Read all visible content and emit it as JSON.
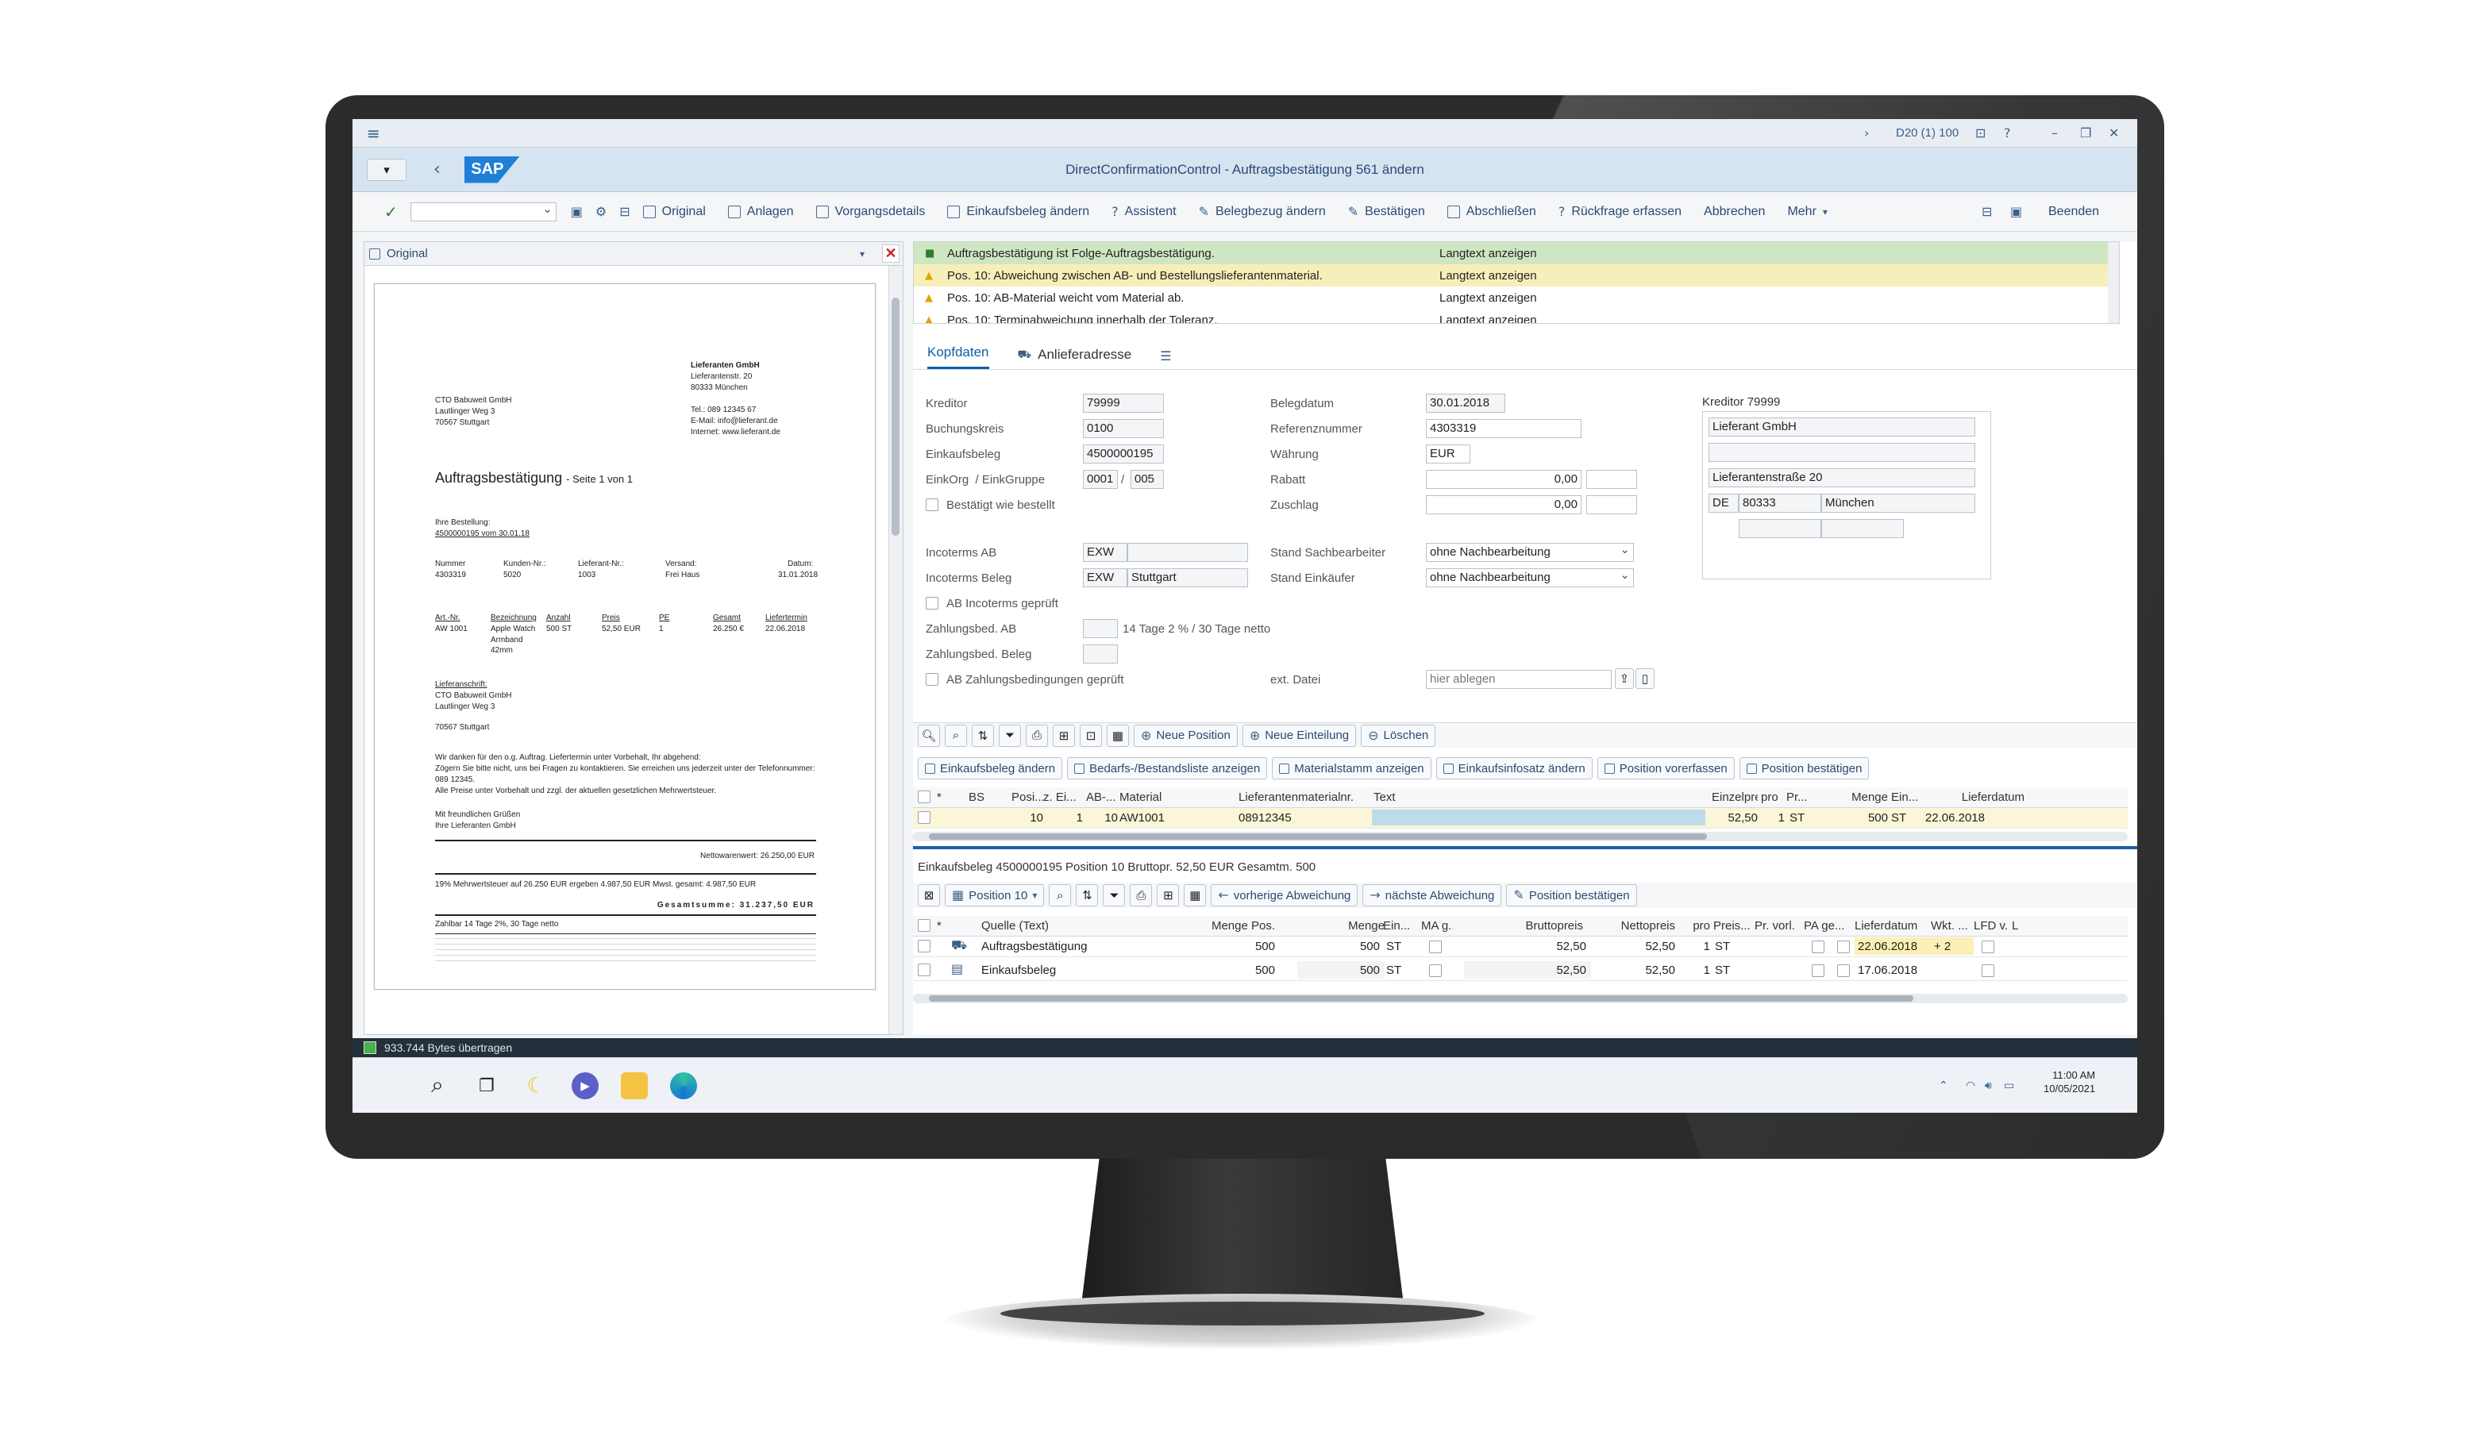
{
  "shell": {
    "menu_icon": "hamburger-icon",
    "system_info": "D20 (1) 100",
    "logo_text": "SAP",
    "window_title": "DirectConfirmationControl - Auftragsbestätigung 561 ändern"
  },
  "toolbar": {
    "items": [
      "Original",
      "Anlagen",
      "Vorgangsdetails",
      "Einkaufsbeleg ändern",
      "Assistent",
      "Belegbezug ändern",
      "Bestätigen",
      "Abschließen",
      "Rückfrage erfassen",
      "Abbrechen",
      "Mehr"
    ],
    "end_label": "Beenden"
  },
  "left_pane": {
    "header_label": "Original",
    "doc": {
      "sender_name": "Lieferanten GmbH",
      "sender_street": "Lieferantenstr. 20",
      "sender_city": "80333 München",
      "recipient_name": "CTO Babuweit GmbH",
      "recipient_street": "Lautlinger Weg 3",
      "recipient_city": "70567 Stuttgart",
      "phone": "Tel.: 089 12345 67",
      "email": "E-Mail: info@lieferant.de",
      "internet": "Internet: www.lieferant.de",
      "title": "Auftragsbestätigung",
      "page": "- Seite 1 von 1",
      "order_label": "Ihre Bestellung:",
      "order_value": "4500000195 vom 30.01.18",
      "head_cols": [
        "Nummer",
        "Kunden-Nr.:",
        "Lieferant-Nr.:",
        "Versand:",
        "Datum:"
      ],
      "head_vals": [
        "4303319",
        "5020",
        "1003",
        "Frei Haus",
        "31.01.2018"
      ],
      "item_cols": [
        "Art.-Nr.",
        "Bezeichnung",
        "Anzahl",
        "Preis",
        "PE",
        "Gesamt",
        "Liefertermin"
      ],
      "item_vals": [
        "AW 1001",
        "Apple Watch Armband 42mm",
        "500 ST",
        "52,50 EUR",
        "1",
        "26.250 €",
        "22.06.2018"
      ],
      "delivery_label": "Lieferanschrift:",
      "delivery_name": "CTO Babuweit GmbH",
      "delivery_street": "Lautlinger Weg 3",
      "delivery_city": "70567 Stuttgart",
      "body1": "Wir danken für den o.g. Auftrag. Liefertermin unter Vorbehalt, Ihr abgehend:",
      "body2": "Zögern Sie bitte nicht, uns bei Fragen zu kontaktieren. Sie erreichen uns jederzeit unter der Telefonnummer: 089 12345.",
      "body3": "Alle Preise unter Vorbehalt und zzgl. der aktuellen gesetzlichen Mehrwertsteuer.",
      "greet1": "Mit freundlichen Grüßen",
      "greet2": "Ihre Lieferanten GmbH",
      "net": "Nettowarenwert: 26.250,00 EUR",
      "vat": "19% Mehrwertsteuer auf     26.250 EUR     ergeben     4.987,50 EUR     Mwst. gesamt:   4.987,50 EUR",
      "total": "Gesamtsumme: 31.237,50 EUR",
      "terms": "Zahlbar 14 Tage 2%, 30 Tage netto"
    }
  },
  "messages": [
    {
      "text": "Auftragsbestätigung ist Folge-Auftragsbestätigung.",
      "link": "Langtext anzeigen",
      "color": "#cfe6c2",
      "icon": "success-square-icon"
    },
    {
      "text": "Pos. 10: Abweichung zwischen AB- und Bestellungslieferantenmaterial.",
      "link": "Langtext anzeigen",
      "color": "#f7efb9",
      "icon": "warning-triangle-icon"
    },
    {
      "text": "Pos. 10: AB-Material weicht vom Material ab.",
      "link": "Langtext anzeigen",
      "color": "#ffffff",
      "icon": "warning-triangle-icon"
    },
    {
      "text": "Pos. 10: Terminabweichung innerhalb der Toleranz.",
      "link": "Langtext anzeigen",
      "color": "#ffffff",
      "icon": "warning-triangle-icon"
    }
  ],
  "tabs": {
    "kopf": "Kopfdaten",
    "anliefer": "Anlieferadresse"
  },
  "header": {
    "kreditor_label": "Kreditor",
    "kreditor": "79999",
    "bukrs_label": "Buchungskreis",
    "bukrs": "0100",
    "ebeln_label": "Einkaufsbeleg",
    "ebeln": "4500000195",
    "ekorg_label": "EinkOrg",
    "ekgrp_sep": "/",
    "ekgrp_label": "EinkGruppe",
    "ekorg": "0001",
    "slash": "/",
    "ekgrp": "005",
    "bestaetigt_label": "Bestätigt wie bestellt",
    "belegdatum_label": "Belegdatum",
    "belegdatum": "30.01.2018",
    "referenz_label": "Referenznummer",
    "referenz": "4303319",
    "waehrung_label": "Währung",
    "waehrung": "EUR",
    "rabatt_label": "Rabatt",
    "rabatt": "0,00",
    "zuschlag_label": "Zuschlag",
    "zuschlag": "0,00",
    "inco_ab_label": "Incoterms AB",
    "inco_ab": "EXW",
    "inco_beleg_label": "Incoterms Beleg",
    "inco_beleg": "EXW",
    "inco_beleg_ort": "Stuttgart",
    "inco_geprueft_label": "AB Incoterms geprüft",
    "zb_ab_label": "Zahlungsbed. AB",
    "zb_ab_text": "14 Tage 2 % / 30 Tage netto",
    "zb_beleg_label": "Zahlungsbed. Beleg",
    "zb_geprueft_label": "AB Zahlungsbedingungen geprüft",
    "stand_sb_label": "Stand Sachbearbeiter",
    "stand_sb": "ohne Nachbearbeitung",
    "stand_ek_label": "Stand Einkäufer",
    "stand_ek": "ohne Nachbearbeitung",
    "ext_label": "ext. Datei",
    "ext_placeholder": "hier ablegen",
    "vendor_title": "Kreditor 79999",
    "vendor_name": "Lieferant GmbH",
    "vendor_street": "Lieferantenstraße 20",
    "vendor_country": "DE",
    "vendor_zip": "80333",
    "vendor_city": "München"
  },
  "items_toolbar": {
    "neue_position": "Neue Position",
    "neue_einteilung": "Neue Einteilung",
    "loeschen": "Löschen"
  },
  "items_actions": [
    "Einkaufsbeleg ändern",
    "Bedarfs-/Bestandsliste anzeigen",
    "Materialstamm anzeigen",
    "Einkaufsinfosatz ändern",
    "Position vorerfassen",
    "Position bestätigen"
  ],
  "items_grid": {
    "cols": [
      "*",
      "BS",
      "Posi...",
      "z. Ei...",
      "AB-...",
      "Material",
      "Lieferantenmaterialnr.",
      "Text",
      "Einzelpreis",
      "pro",
      "Pr...",
      "Menge",
      "Ein...",
      "Lieferdatum"
    ],
    "row": [
      "10",
      "1",
      "10",
      "AW1001",
      "08912345",
      "52,50",
      "1",
      "ST",
      "500",
      "ST",
      "22.06.2018"
    ]
  },
  "detail": {
    "caption": "Einkaufsbeleg 4500000195 Position 10 Bruttopr. 52,50 EUR Gesamtm. 500",
    "pos_select": "Position 10",
    "prev": "vorherige Abweichung",
    "next": "nächste Abweichung",
    "confirm": "Position bestätigen",
    "cols": [
      "*",
      "Quelle (Text)",
      "Menge Pos.",
      "Menge",
      "Ein...",
      "MA g...",
      "Bruttopreis",
      "Nettopreis",
      "pro",
      "Preis...",
      "Pr. vorl.",
      "PA ge...",
      "Lieferdatum",
      "Wkt. ...",
      "LFD v...",
      "L"
    ],
    "rows": [
      {
        "quelle": "Auftragsbestätigung",
        "mp": "500",
        "m": "500",
        "ein": "ST",
        "brutto": "52,50",
        "netto": "52,50",
        "pro": "1",
        "pe": "ST",
        "datum": "22.06.2018",
        "wkt": "+ 2"
      },
      {
        "quelle": "Einkaufsbeleg",
        "mp": "500",
        "m": "500",
        "ein": "ST",
        "brutto": "52,50",
        "netto": "52,50",
        "pro": "1",
        "pe": "ST",
        "datum": "17.06.2018",
        "wkt": ""
      }
    ]
  },
  "status_bar": {
    "text": "933.744 Bytes übertragen"
  },
  "taskbar": {
    "time": "11:00 AM",
    "date": "10/05/2021"
  }
}
